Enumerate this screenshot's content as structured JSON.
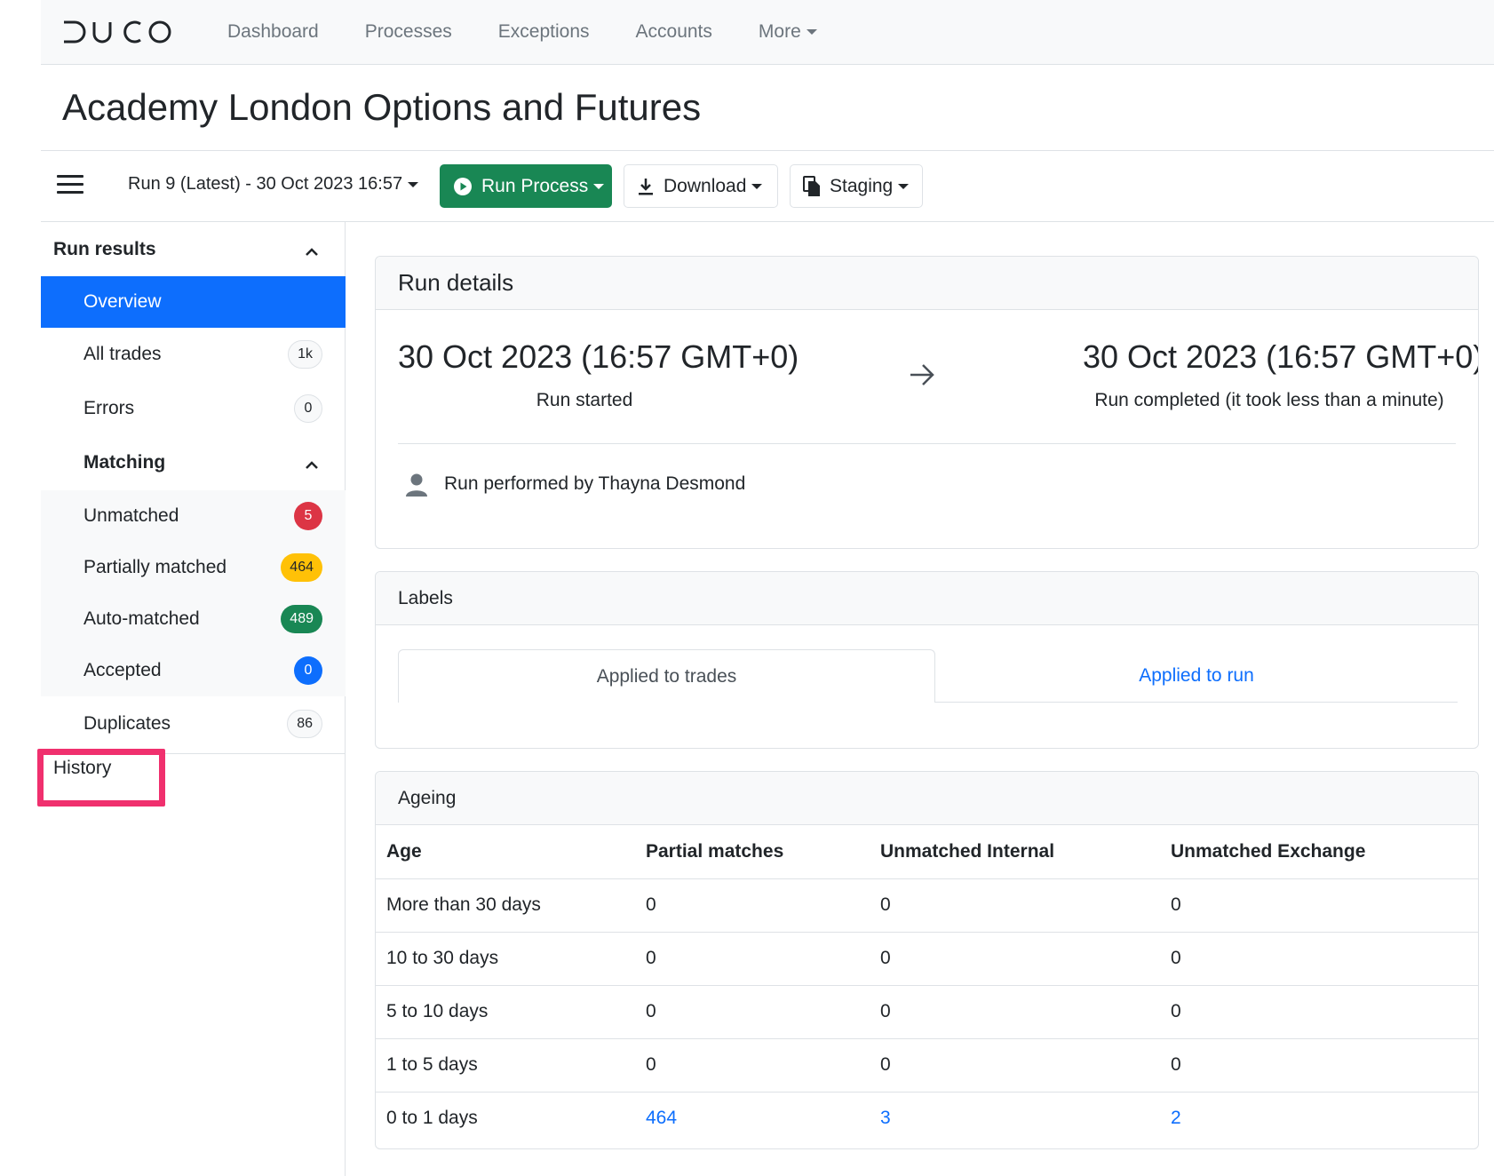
{
  "nav": {
    "logo_text": "DUCO",
    "links": [
      "Dashboard",
      "Processes",
      "Exceptions",
      "Accounts"
    ],
    "more_label": "More"
  },
  "page": {
    "title": "Academy London Options and Futures"
  },
  "toolbar": {
    "run_select": "Run 9 (Latest) - 30 Oct 2023 16:57",
    "run_process_label": "Run Process",
    "download_label": "Download",
    "staging_label": "Staging",
    "run_color": "#198754"
  },
  "sidebar": {
    "run_results_label": "Run results",
    "overview_label": "Overview",
    "all_trades": {
      "label": "All trades",
      "count": "1k"
    },
    "errors": {
      "label": "Errors",
      "count": "0"
    },
    "matching_label": "Matching",
    "unmatched": {
      "label": "Unmatched",
      "count": "5"
    },
    "partially_matched": {
      "label": "Partially matched",
      "count": "464"
    },
    "auto_matched": {
      "label": "Auto-matched",
      "count": "489"
    },
    "accepted": {
      "label": "Accepted",
      "count": "0"
    },
    "duplicates": {
      "label": "Duplicates",
      "count": "86"
    },
    "history_label": "History",
    "highlight_color": "#f0306e"
  },
  "run_details": {
    "header": "Run details",
    "start_date": "30 Oct 2023 (16:57 GMT+0)",
    "start_label": "Run started",
    "end_date": "30 Oct 2023 (16:57 GMT+0)",
    "end_label": "Run completed (it took less than a minute)",
    "performed_by": "Run performed by Thayna Desmond"
  },
  "labels": {
    "header": "Labels",
    "tab_trades": "Applied to trades",
    "tab_run": "Applied to run"
  },
  "ageing": {
    "header": "Ageing",
    "columns": [
      "Age",
      "Partial matches",
      "Unmatched Internal",
      "Unmatched Exchange"
    ],
    "rows": [
      [
        "More than 30 days",
        "0",
        "0",
        "0"
      ],
      [
        "10 to 30 days",
        "0",
        "0",
        "0"
      ],
      [
        "5 to 10 days",
        "0",
        "0",
        "0"
      ],
      [
        "1 to 5 days",
        "0",
        "0",
        "0"
      ],
      [
        "0 to 1 days",
        "464",
        "3",
        "2"
      ]
    ]
  }
}
